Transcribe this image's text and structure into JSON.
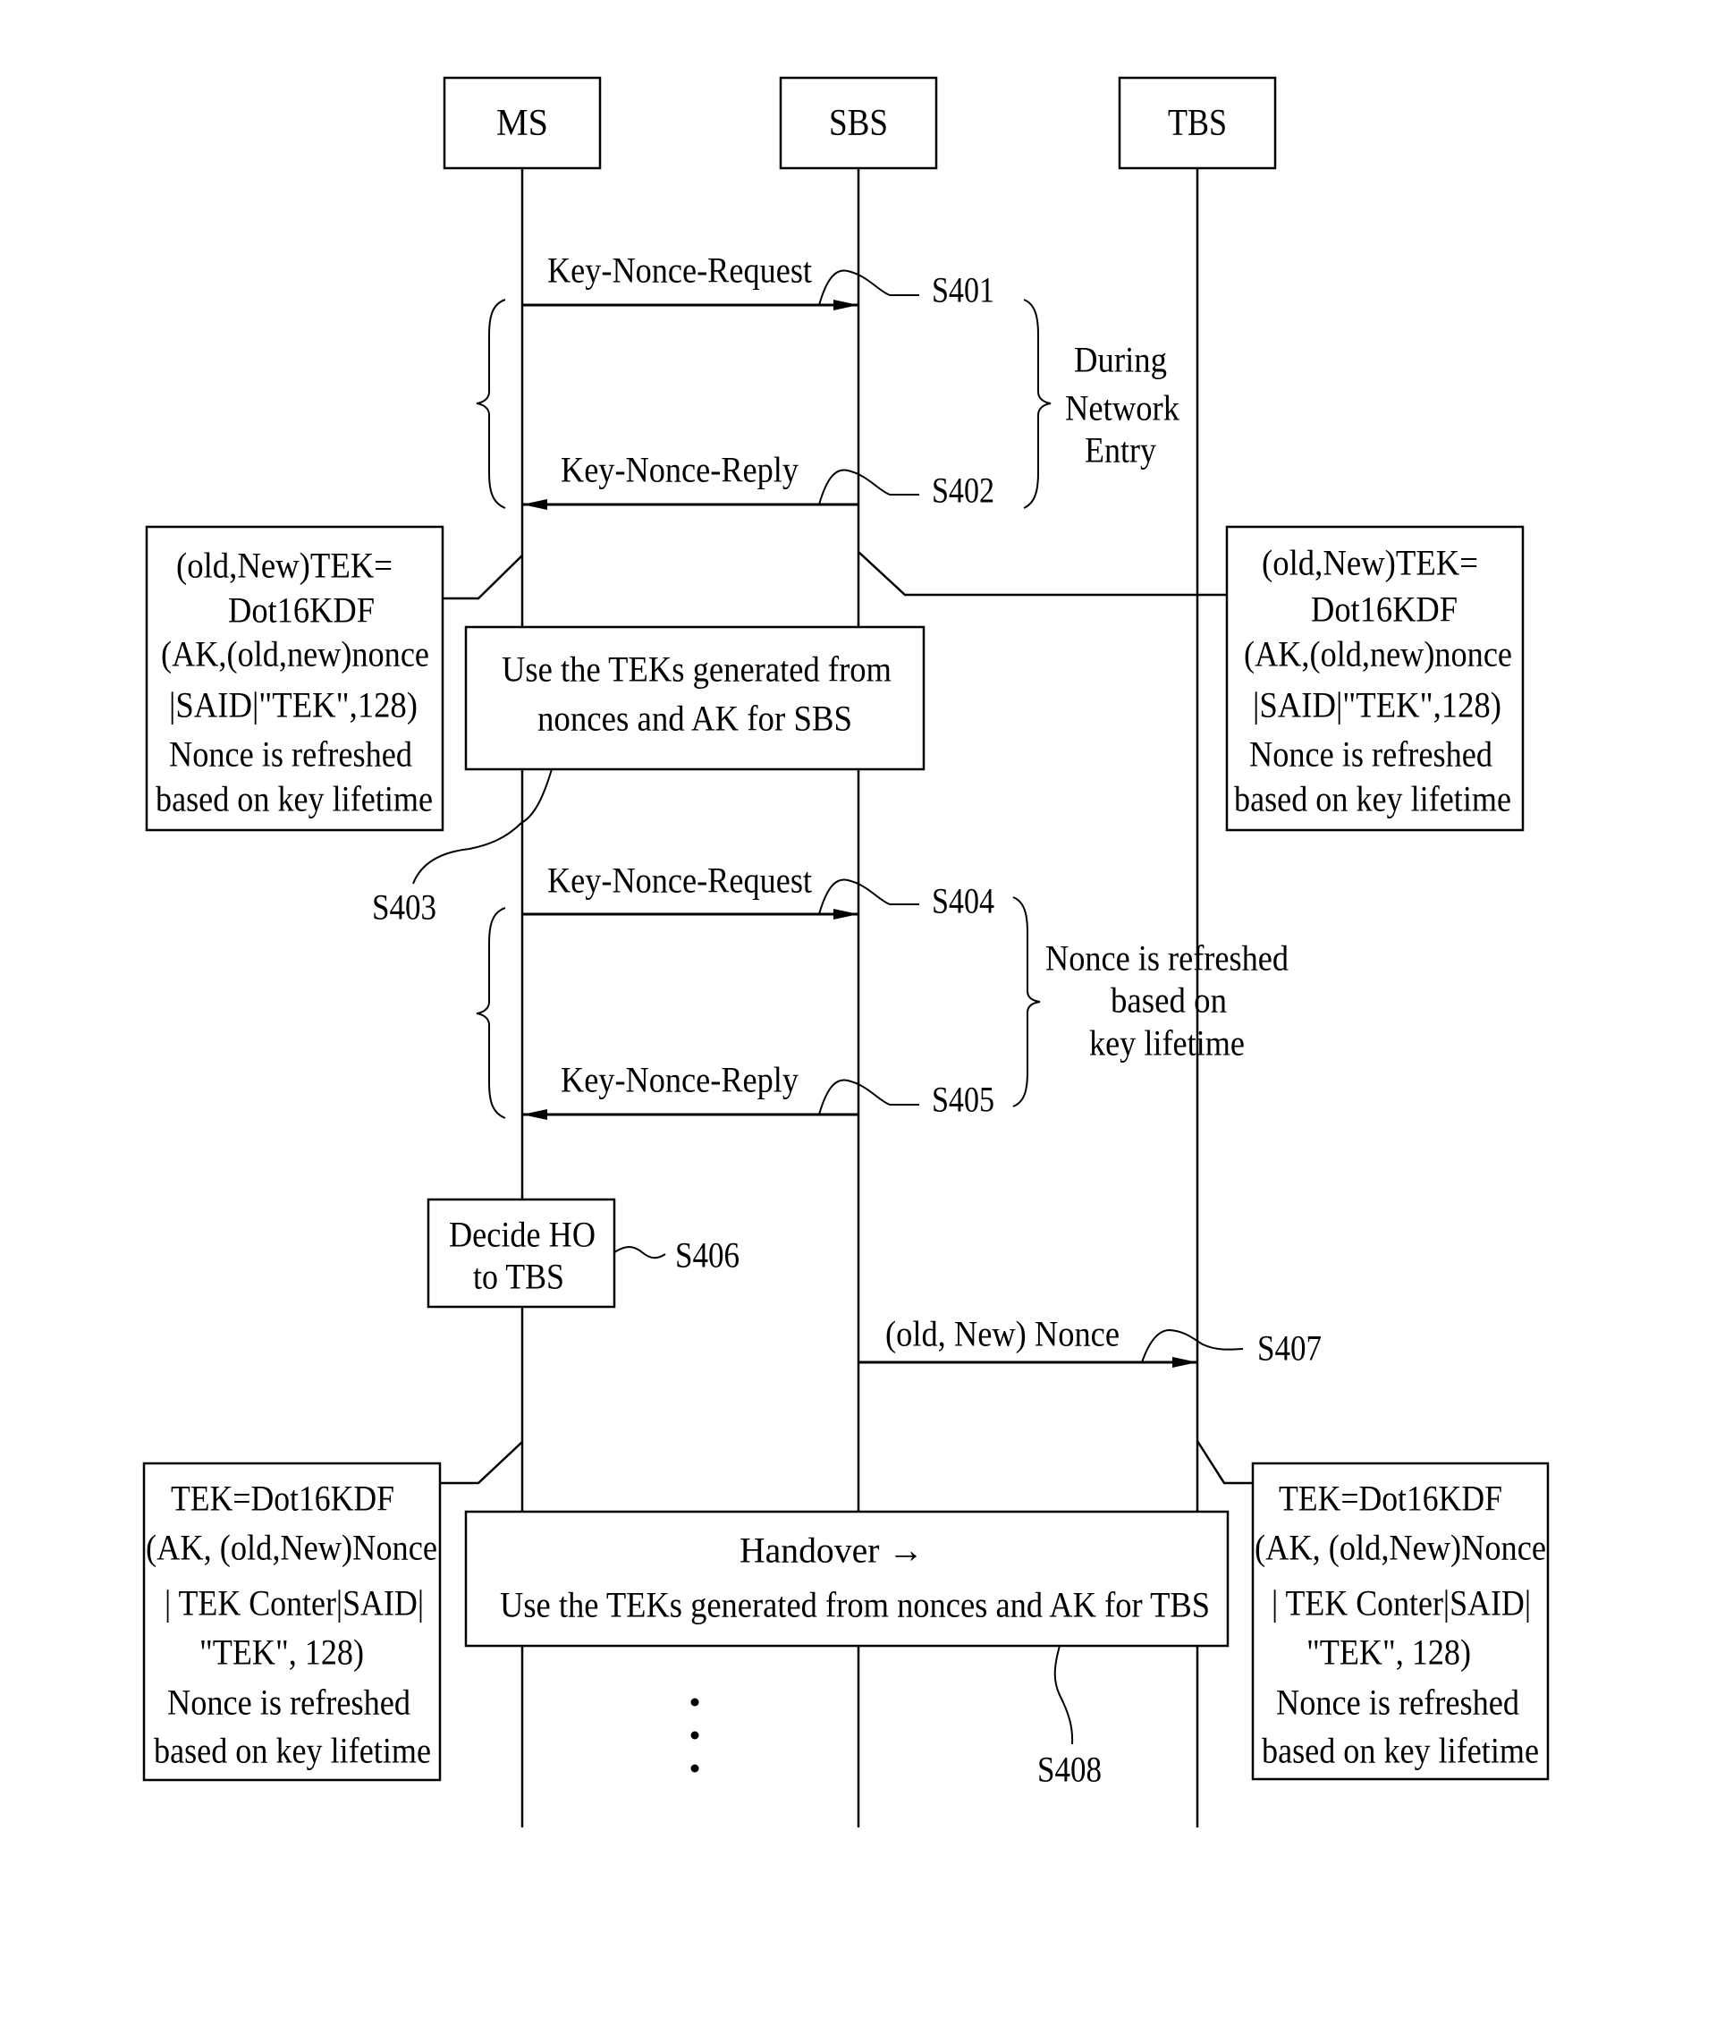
{
  "participants": [
    {
      "id": "ms",
      "label": "MS"
    },
    {
      "id": "sbs",
      "label": "SBS"
    },
    {
      "id": "tbs",
      "label": "TBS"
    }
  ],
  "messages": [
    {
      "step": "S401",
      "label": "Key-Nonce-Request",
      "from": "MS",
      "to": "SBS"
    },
    {
      "step": "S402",
      "label": "Key-Nonce-Reply",
      "from": "SBS",
      "to": "MS"
    },
    {
      "step": "S404",
      "label": "Key-Nonce-Request",
      "from": "MS",
      "to": "SBS"
    },
    {
      "step": "S405",
      "label": "Key-Nonce-Reply",
      "from": "SBS",
      "to": "MS"
    },
    {
      "step": "S407",
      "label": "(old, New) Nonce",
      "from": "SBS",
      "to": "TBS"
    }
  ],
  "phases": {
    "network_entry": [
      "During",
      "Network",
      "Entry"
    ],
    "refresh": [
      "Nonce is refreshed",
      "based on",
      "key lifetime"
    ]
  },
  "notes": {
    "ms_tek_initial": [
      "(old,New)TEK=",
      "Dot16KDF",
      "(AK,(old,new)nonce",
      "|SAID|\"TEK\",128)",
      "Nonce is refreshed",
      "based on key lifetime"
    ],
    "sbs_tek_initial": [
      "(old,New)TEK=",
      "Dot16KDF",
      "(AK,(old,new)nonce",
      "|SAID|\"TEK\",128)",
      "Nonce is refreshed",
      "based on key lifetime"
    ],
    "use_teks_sbs": {
      "step": "S403",
      "lines": [
        "Use the TEKs generated from",
        "nonces and AK for SBS"
      ]
    },
    "decide_ho": {
      "step": "S406",
      "lines": [
        "Decide HO",
        "to TBS"
      ]
    },
    "ms_tek_handover": [
      "TEK=Dot16KDF",
      "(AK, (old,New)Nonce",
      "| TEK Conter|SAID|",
      "\"TEK\", 128)",
      "Nonce is refreshed",
      "based on key lifetime"
    ],
    "tbs_tek_handover": [
      "TEK=Dot16KDF",
      "(AK, (old,New)Nonce",
      "| TEK Conter|SAID|",
      "\"TEK\", 128)",
      "Nonce is refreshed",
      "based on key lifetime"
    ],
    "handover": {
      "step": "S408",
      "lines": [
        "Handover →",
        "Use the TEKs generated from nonces and AK for TBS"
      ]
    }
  },
  "continuation": "⋮"
}
